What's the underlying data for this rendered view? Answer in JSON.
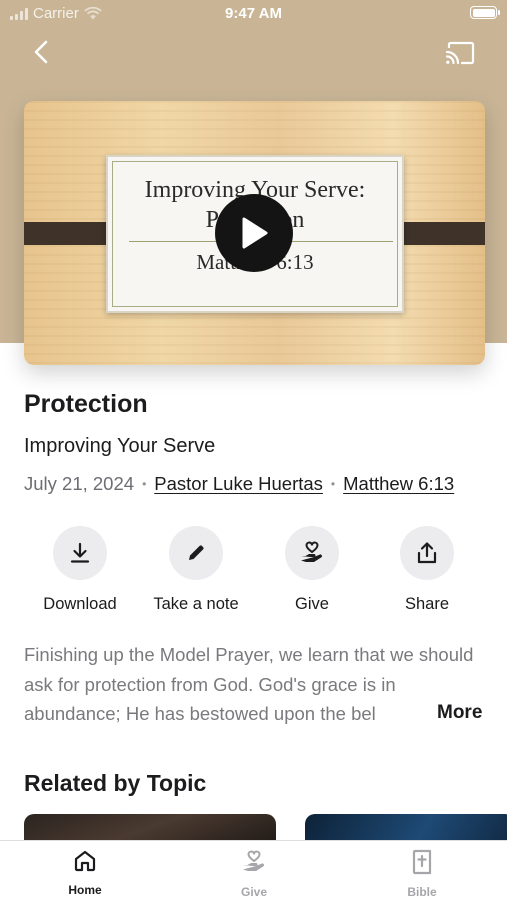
{
  "status_bar": {
    "carrier": "Carrier",
    "time": "9:47 AM"
  },
  "video": {
    "slide_title": "Improving Your Serve: Protection",
    "slide_reference": "Matthew 6:13"
  },
  "sermon": {
    "title": "Protection",
    "series": "Improving Your Serve",
    "date": "July 21, 2024",
    "speaker": "Pastor Luke Huertas",
    "scripture": "Matthew 6:13"
  },
  "actions": [
    {
      "label": "Download",
      "icon": "download-icon"
    },
    {
      "label": "Take a note",
      "icon": "pencil-icon"
    },
    {
      "label": "Give",
      "icon": "give-heart-hand-icon"
    },
    {
      "label": "Share",
      "icon": "share-icon"
    }
  ],
  "description": {
    "text": "Finishing up the Model Prayer, we learn that we should ask for protection from God. God's grace is in abundance; He has bestowed upon the bel",
    "more_label": "More"
  },
  "related": {
    "title": "Related by Topic"
  },
  "tab_bar": {
    "tabs": [
      {
        "label": "Home",
        "icon": "home-icon",
        "active": true
      },
      {
        "label": "Give",
        "icon": "give-heart-hand-icon",
        "active": false
      },
      {
        "label": "Bible",
        "icon": "bible-icon",
        "active": false
      }
    ]
  },
  "colors": {
    "hero_background": "#c9b596",
    "text_primary": "#1c1c1e",
    "text_secondary": "#6d6d72",
    "action_circle": "#ececee"
  }
}
